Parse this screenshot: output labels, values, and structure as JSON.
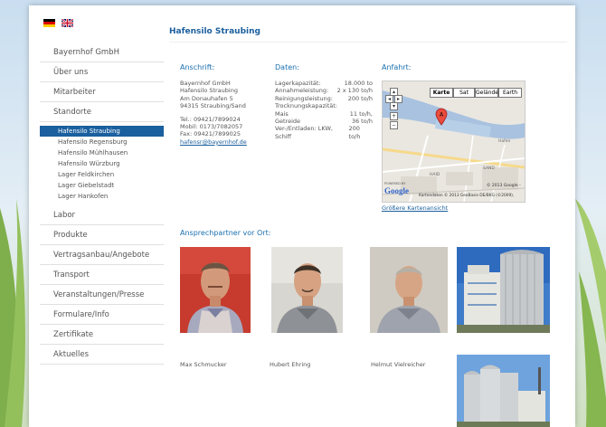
{
  "colors": {
    "accent": "#1a5f9e",
    "active_bg": "#1a5f9e"
  },
  "flags": [
    {
      "name": "german-flag-icon"
    },
    {
      "name": "uk-flag-icon"
    }
  ],
  "nav": {
    "items_top": [
      "Bayernhof GmbH",
      "Über uns",
      "Mitarbeiter",
      "Standorte"
    ],
    "sub": [
      "Hafensilo Straubing",
      "Hafensilo Regensburg",
      "Hafensilo Mühlhausen",
      "Hafensilo Würzburg",
      "Lager Feldkirchen",
      "Lager Giebelstadt",
      "Lager Hankofen"
    ],
    "active_sub": "Hafensilo Straubing",
    "items_bottom": [
      "Labor",
      "Produkte",
      "Vertragsanbau/Angebote",
      "Transport",
      "Veranstaltungen/Presse",
      "Formulare/Info",
      "Zertifikate",
      "Aktuelles"
    ]
  },
  "page": {
    "title": "Hafensilo Straubing",
    "anschrift": {
      "heading": "Anschrift:",
      "lines": [
        "Bayernhof GmbH",
        "Hafensilo Straubing",
        "Am Donauhafen 5",
        "94315 Straubing/Sand"
      ],
      "tel": "Tel.: 09421/7899024",
      "mobil": "Mobil: 0173/7082057",
      "fax": "Fax: 09421/7899025",
      "email": "hafensr@bayernhof.de"
    },
    "daten": {
      "heading": "Daten:",
      "rows": [
        {
          "label": "Lagerkapazität:",
          "value": "18.000 to"
        },
        {
          "label": "Annahmeleistung:",
          "value": "2 x 130 to/h"
        },
        {
          "label": "Reinigungsleistung:",
          "value": "200 to/h"
        },
        {
          "label": "Trocknungskapazität:",
          "value": ""
        },
        {
          "label": "Mais",
          "value": "11 to/h,"
        },
        {
          "label": "Getreide",
          "value": "36 to/h"
        },
        {
          "label": "Ver-/Entladen: LKW, Schiff",
          "value": "200 to/h"
        }
      ]
    },
    "anfahrt": {
      "heading": "Anfahrt:",
      "map_types": [
        "Karte",
        "Sat",
        "Gelände",
        "Earth"
      ],
      "map_labels": [
        "Hafen",
        "HAID",
        "SAND"
      ],
      "map_marker": "A",
      "google": "Google",
      "powered": "POWERED BY",
      "copyright": "Kartendaten © 2013 GeoBasis-DE/BKG (©2009),",
      "copyright2": "© 2013 Google -",
      "link": "Größere Kartenansicht"
    },
    "contacts": {
      "heading": "Ansprechpartner vor Ort:",
      "names": [
        "Max Schmucker",
        "Hubert Ehring",
        "Helmut Vielreicher"
      ]
    }
  }
}
